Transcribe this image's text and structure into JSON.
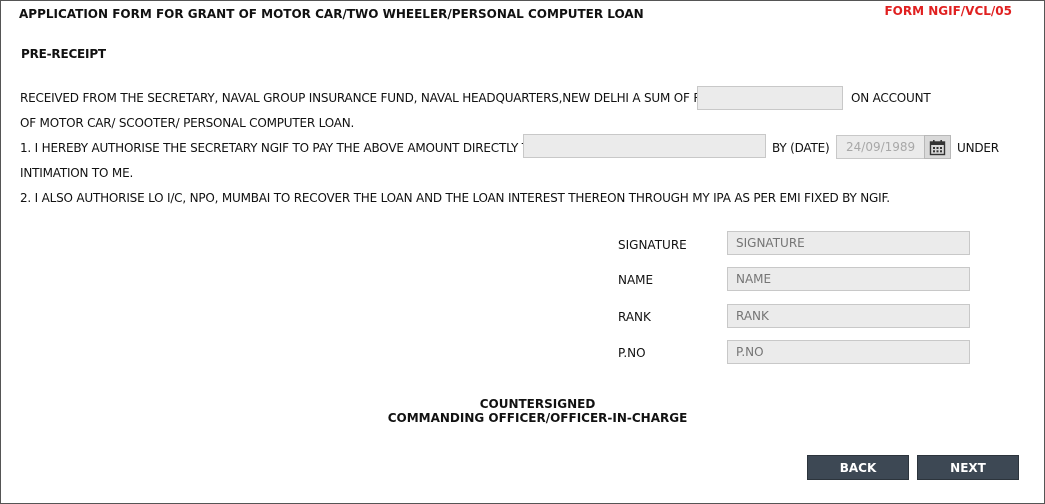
{
  "header": {
    "title": "APPLICATION FORM FOR GRANT OF MOTOR CAR/TWO WHEELER/PERSONAL COMPUTER LOAN",
    "form_no": "FORM NGIF/VCL/05"
  },
  "section": {
    "heading": "PRE-RECEIPT"
  },
  "receipt": {
    "line1_pre": "RECEIVED FROM THE SECRETARY, NAVAL GROUP INSURANCE FUND, NAVAL HEADQUARTERS,NEW DELHI A SUM OF RS.",
    "line1_post": "ON ACCOUNT",
    "line2": "OF MOTOR CAR/ SCOOTER/ PERSONAL COMPUTER LOAN.",
    "amount_value": ""
  },
  "authorise": {
    "line1_pre": "1. I HEREBY AUTHORISE THE SECRETARY NGIF TO PAY THE ABOVE AMOUNT DIRECTLY TO",
    "by_date_label": "BY (DATE)",
    "date_value": "24/09/1989",
    "line1_post": "UNDER",
    "line2": "INTIMATION TO ME.",
    "payee_value": "",
    "line3": "2. I ALSO AUTHORISE LO I/C, NPO, MUMBAI TO RECOVER THE LOAN AND THE LOAN INTEREST THEREON THROUGH MY IPA AS PER EMI FIXED BY NGIF."
  },
  "signature_block": {
    "signature_label": "SIGNATURE",
    "signature_placeholder": "SIGNATURE",
    "name_label": "NAME",
    "name_placeholder": "NAME",
    "rank_label": "RANK",
    "rank_placeholder": "RANK",
    "pno_label": "P.NO",
    "pno_placeholder": "P.NO"
  },
  "countersign": {
    "line1": "COUNTERSIGNED",
    "line2": "COMMANDING OFFICER/OFFICER-IN-CHARGE"
  },
  "nav": {
    "back_label": "BACK",
    "next_label": "NEXT"
  },
  "icons": {
    "calendar": "calendar-icon"
  },
  "colors": {
    "form_no": "#e02020",
    "button_bg": "#3d4854",
    "field_bg": "#ebebeb"
  }
}
